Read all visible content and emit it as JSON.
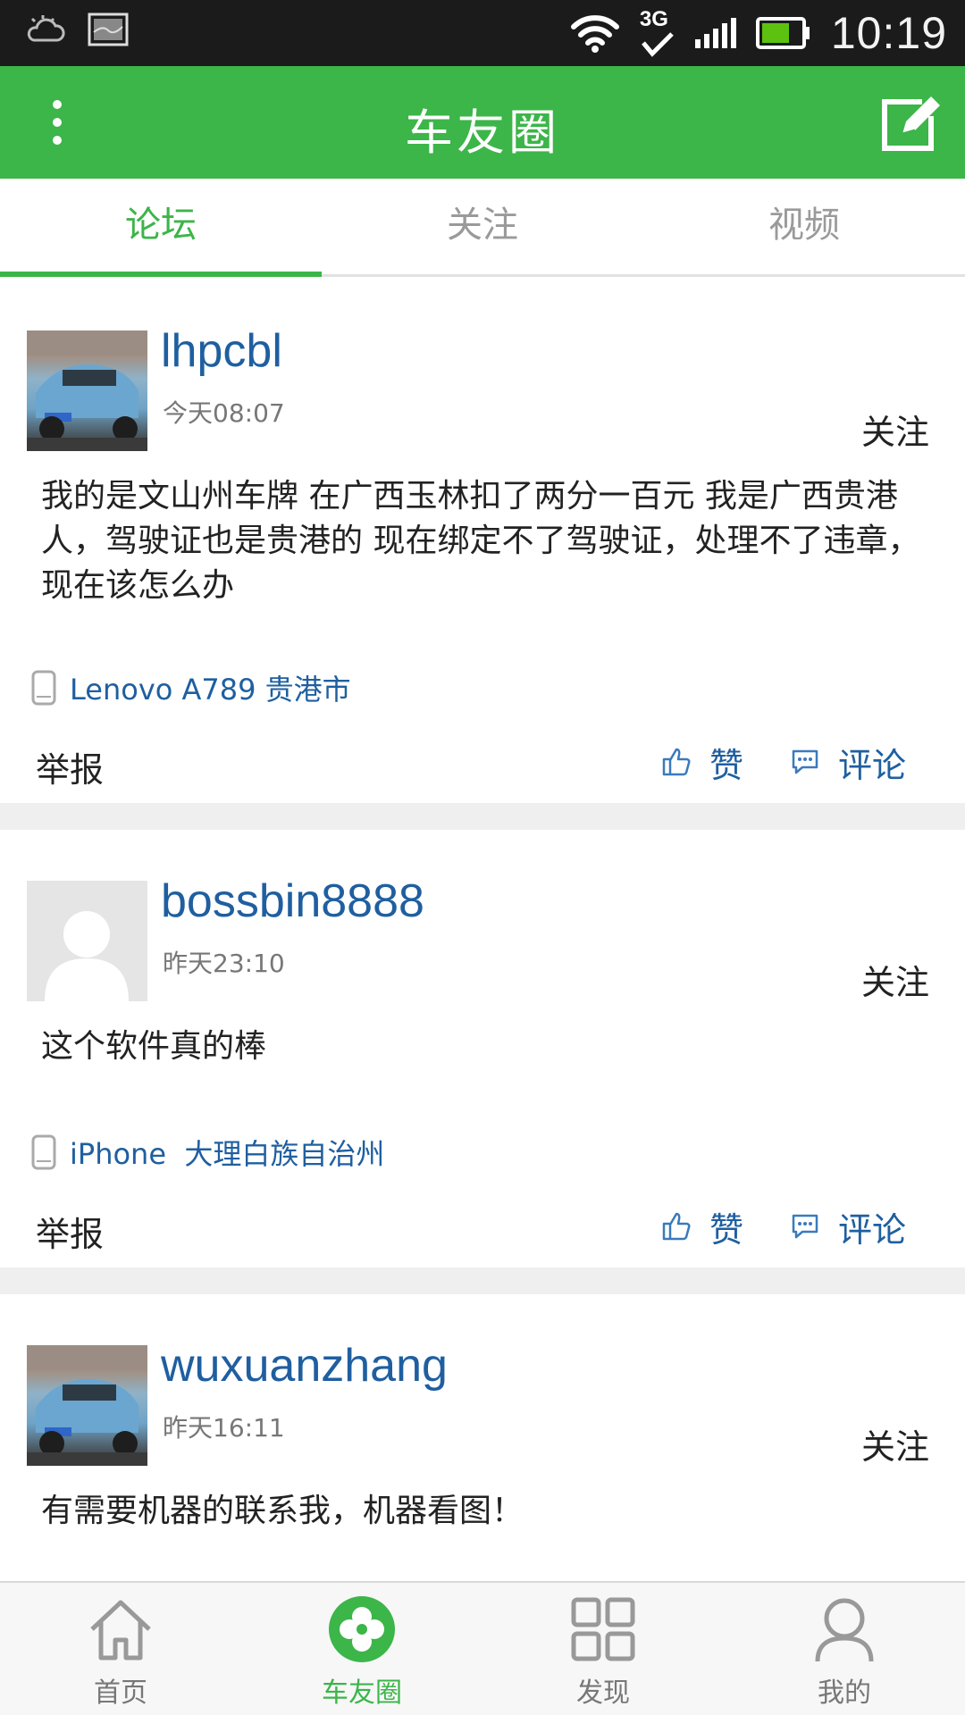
{
  "status_bar": {
    "time": "10:19",
    "network": "3G",
    "icons": [
      "weather-icon",
      "screenshot-icon",
      "wifi-icon",
      "3g-icon",
      "signal-icon",
      "battery-icon"
    ]
  },
  "header": {
    "title": "车友圈",
    "menu_icon": "more-vertical-icon",
    "edit_icon": "edit-icon"
  },
  "tabs": [
    {
      "label": "论坛",
      "active": true
    },
    {
      "label": "关注",
      "active": false
    },
    {
      "label": "视频",
      "active": false
    }
  ],
  "posts": [
    {
      "username": "lhpcbl",
      "time": "今天08:07",
      "follow_label": "关注",
      "content": "我的是文山州车牌 在广西玉林扣了两分一百元 我是广西贵港人，驾驶证也是贵港的 现在绑定不了驾驶证，处理不了违章，现在该怎么办",
      "device": "Lenovo A789 贵港市",
      "report_label": "举报",
      "like_label": "赞",
      "comment_label": "评论",
      "avatar": "car-photo"
    },
    {
      "username": "bossbin8888",
      "time": "昨天23:10",
      "follow_label": "关注",
      "content": "这个软件真的棒",
      "device": "iPhone  大理白族自治州",
      "report_label": "举报",
      "like_label": "赞",
      "comment_label": "评论",
      "avatar": "default-avatar"
    },
    {
      "username": "wuxuanzhang",
      "time": "昨天16:11",
      "follow_label": "关注",
      "content": "有需要机器的联系我，机器看图！",
      "avatar": "car-photo"
    }
  ],
  "bottom_nav": [
    {
      "label": "首页",
      "icon": "home-icon",
      "active": false
    },
    {
      "label": "车友圈",
      "icon": "clover-icon",
      "active": true
    },
    {
      "label": "发现",
      "icon": "grid-icon",
      "active": false
    },
    {
      "label": "我的",
      "icon": "user-icon",
      "active": false
    }
  ],
  "colors": {
    "brand_green": "#3cb549",
    "link_blue": "#1f5fa0",
    "status_bar": "#1b1b1b"
  }
}
